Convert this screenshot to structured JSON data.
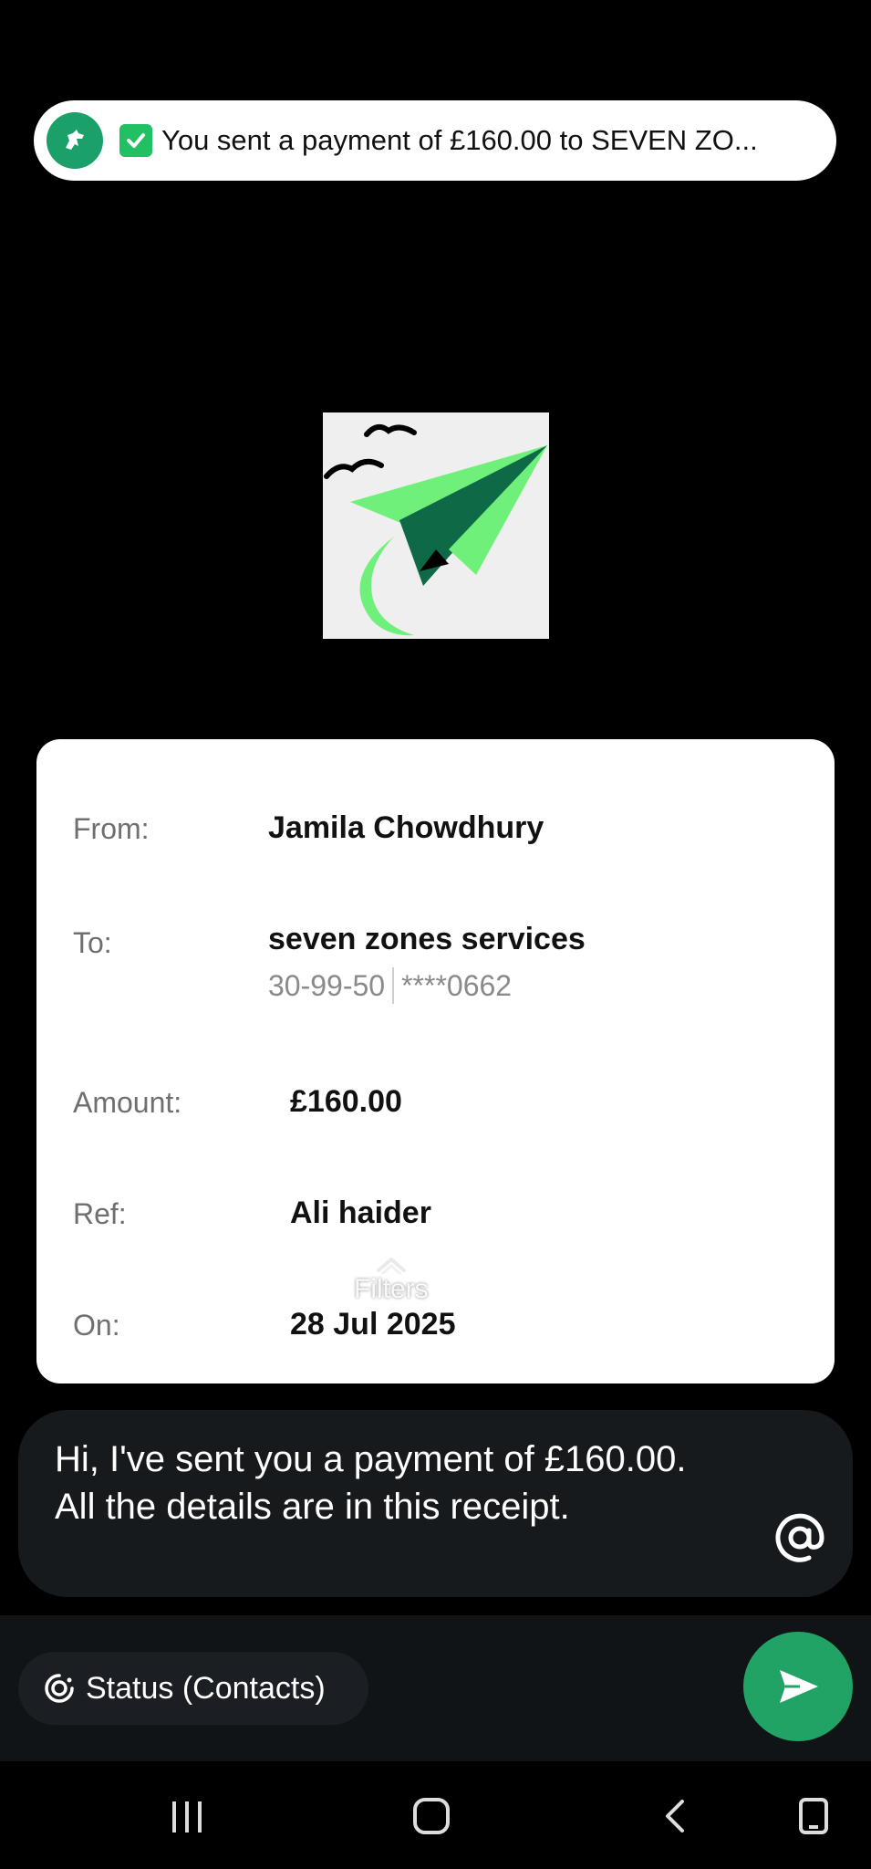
{
  "notification": {
    "app_icon": "lloyds-horse-icon",
    "check_icon": "check-box-icon",
    "text": "You sent a payment of £160.00 to SEVEN ZO..."
  },
  "logo": {
    "icon": "paper-plane-logo"
  },
  "receipt": {
    "from_label": "From:",
    "from_value": "Jamila Chowdhury",
    "to_label": "To:",
    "to_value": "seven zones services",
    "sort_code": "30-99-50",
    "account_masked": "****0662",
    "amount_label": "Amount:",
    "amount_value": "£160.00",
    "ref_label": "Ref:",
    "ref_value": "Ali haider",
    "on_label": "On:",
    "on_value": "28 Jul 2025"
  },
  "filters": {
    "label": "Filters",
    "icon": "chevron-up-icon"
  },
  "message": {
    "text": "Hi, I've sent you a payment of £160.00. All the details are in this receipt.",
    "mention_icon": "at-sign-icon"
  },
  "status": {
    "label": "Status (Contacts)",
    "icon": "status-ring-icon"
  },
  "send": {
    "icon": "send-icon"
  },
  "system_nav": {
    "recents_icon": "recents-icon",
    "home_icon": "home-icon",
    "back_icon": "back-icon",
    "keyboard_icon": "rotate-phone-icon"
  }
}
